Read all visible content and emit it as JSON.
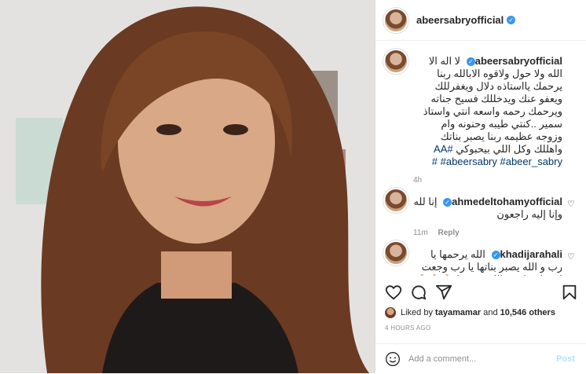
{
  "post": {
    "username": "abeersabryofficial",
    "caption": {
      "username": "abeersabryofficial",
      "text": "لا اله الا الله ولا حول ولاقوه الابالله ربنا يرحمك يااستاذه دلال ويغفرللك ويعفو عنك ويدخللك فسيح جناته ويرحمك رحمه واسعه انتي واستاذ سمير ..كنتي طيبه وحنونه وام وزوجه عظيمه ربنا يصبر بناتك واهللك وكل اللي بيحبوكي",
      "hashtags": "#AA #abeersabry #abeer_sabry #",
      "time": "4h"
    },
    "comments": [
      {
        "username": "ahmedeltohamyofficial",
        "text": "إنا لله وإنا إليه راجعون",
        "time": "11m",
        "reply_label": "Reply"
      },
      {
        "username": "khadijarahali",
        "text": "الله يرحمها يا رب و الله يصبر بناتها يا رب وجعت لي قلبي كتيير الله يرحمها 🙏🏻🙏🏻🙏🏻🙏🏻🙏🏻"
      }
    ],
    "likes": {
      "prefix": "Liked by",
      "user": "tayamamar",
      "middle": "and",
      "count": "10,546 others"
    },
    "timestamp": "4 HOURS AGO",
    "add_comment": {
      "placeholder": "Add a comment...",
      "post_label": "Post"
    },
    "icons": [
      "heart-icon",
      "comment-icon",
      "share-icon",
      "bookmark-icon",
      "emoji-icon",
      "verified-icon"
    ],
    "colors": {
      "verified": "#3897f0",
      "hashtag": "#00376b",
      "post_disabled": "#b2dffc"
    }
  }
}
